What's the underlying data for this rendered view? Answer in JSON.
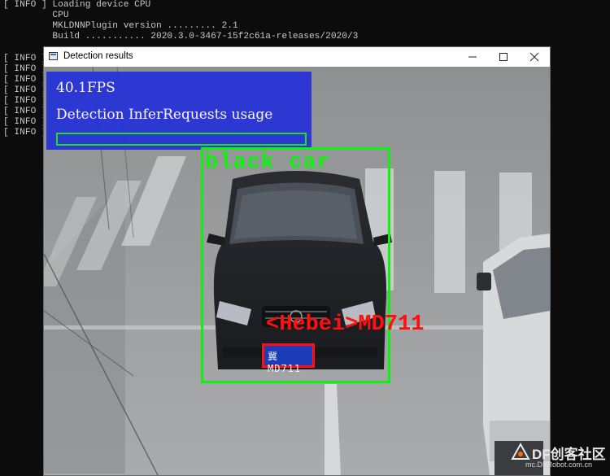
{
  "console": {
    "lines": [
      "[ INFO ] Loading device CPU",
      "         CPU",
      "         MKLDNNPlugin version ......... 2.1",
      "         Build ........... 2020.3.0-3467-15f2c61a-releases/2020/3",
      "",
      "[ INFO ]",
      "[ INFO ]",
      "[ INFO ]",
      "[ INFO ]",
      "[ INFO ]",
      "[ INFO ]",
      "[ INFO ]",
      "[ INFO ]"
    ]
  },
  "window": {
    "title": "Detection results",
    "minimize_icon": "minimize-icon",
    "maximize_icon": "maximize-icon",
    "close_icon": "close-icon"
  },
  "overlay": {
    "fps": "40.1FPS",
    "usage_label": "Detection InferRequests usage",
    "usage_fraction": 0.0,
    "panel_color": "#2530d8",
    "bar_color": "#16e616"
  },
  "detections": {
    "vehicle_label": "black car",
    "vehicle_color": "#10f010",
    "plate_label": "<Hebei>MD711",
    "plate_text": "冀 MD711",
    "plate_color": "#ff1010"
  },
  "watermark": {
    "logo": "DF创客社区",
    "url": "mc.DFRobot.com.cn"
  }
}
